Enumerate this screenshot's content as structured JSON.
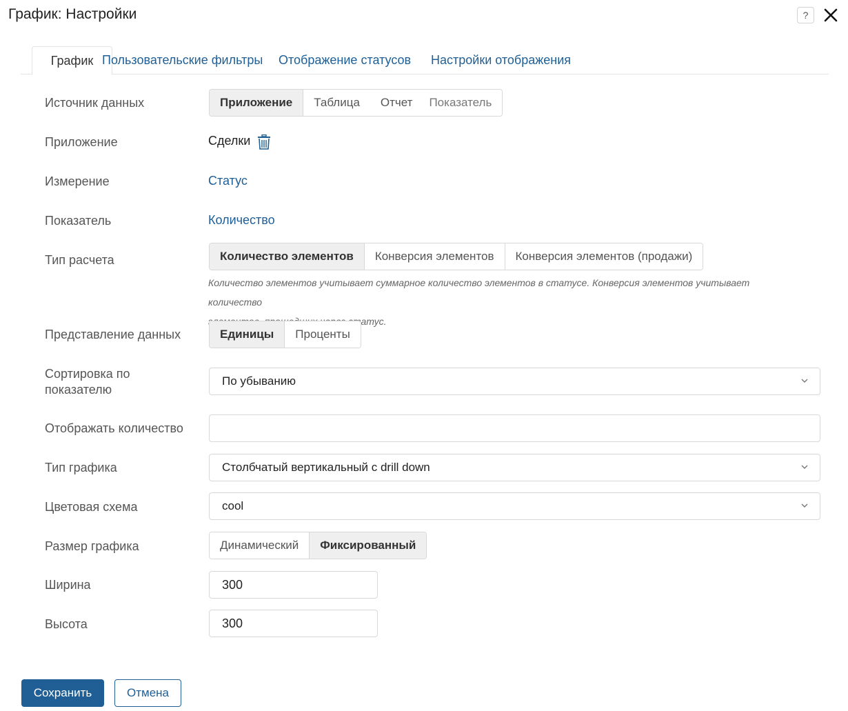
{
  "window": {
    "title": "График: Настройки",
    "help_label": "?"
  },
  "tabs": [
    {
      "label": "График",
      "active": true
    },
    {
      "label": "Пользовательские фильтры",
      "active": false
    },
    {
      "label": "Отображение статусов",
      "active": false
    },
    {
      "label": "Настройки отображения",
      "active": false
    }
  ],
  "form": {
    "data_source": {
      "label": "Источник данных",
      "options": [
        "Приложение",
        "Таблица",
        "Отчет",
        "Показатель"
      ],
      "selected": "Приложение"
    },
    "application": {
      "label": "Приложение",
      "value": "Сделки"
    },
    "dimension": {
      "label": "Измерение",
      "value": "Статус"
    },
    "indicator": {
      "label": "Показатель",
      "value": "Количество"
    },
    "calc_type": {
      "label": "Тип расчета",
      "options": [
        "Количество элементов",
        "Конверсия элементов",
        "Конверсия элементов (продажи)"
      ],
      "selected": "Количество элементов",
      "hint_line1": "Количество элементов учитывает суммарное количество элементов в статусе. Конверсия элементов учитывает количество",
      "hint_line2": "элементов, прошедших через статус."
    },
    "data_view": {
      "label": "Представление данных",
      "options": [
        "Единицы",
        "Проценты"
      ],
      "selected": "Единицы"
    },
    "sort": {
      "label_line1": "Сортировка по",
      "label_line2": "показателю",
      "value": "По убыванию"
    },
    "show_count": {
      "label": "Отображать количество",
      "value": ""
    },
    "chart_type": {
      "label": "Тип графика",
      "value": "Столбчатый вертикальный с drill down"
    },
    "color_scheme": {
      "label": "Цветовая схема",
      "value": "cool"
    },
    "chart_size": {
      "label": "Размер графика",
      "options": [
        "Динамический",
        "Фиксированный"
      ],
      "selected": "Фиксированный"
    },
    "width": {
      "label": "Ширина",
      "value": "300"
    },
    "height": {
      "label": "Высота",
      "value": "300"
    }
  },
  "footer": {
    "save_label": "Сохранить",
    "cancel_label": "Отмена"
  },
  "colors": {
    "accent": "#1f5f95",
    "selected_bg": "#efefef",
    "border": "#d8d8d8"
  }
}
